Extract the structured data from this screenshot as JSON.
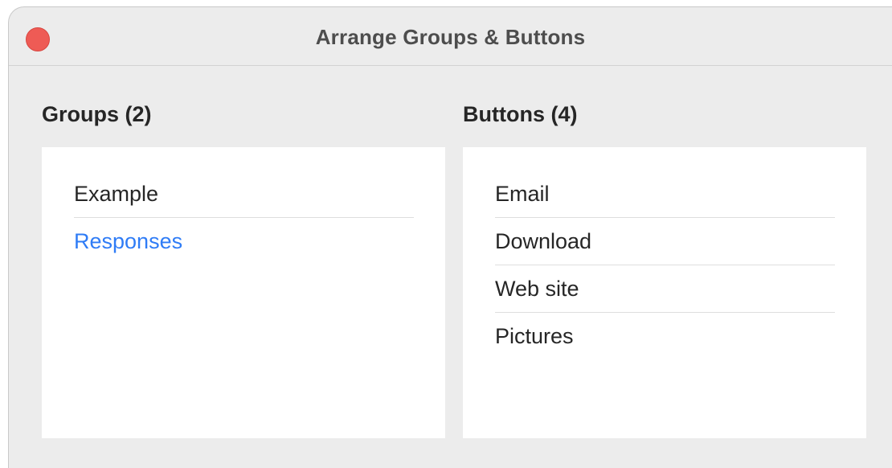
{
  "window": {
    "title": "Arrange Groups & Buttons"
  },
  "groups": {
    "heading": "Groups (2)",
    "items": [
      {
        "label": "Example",
        "selected": false
      },
      {
        "label": "Responses",
        "selected": true
      }
    ]
  },
  "buttons": {
    "heading": "Buttons (4)",
    "items": [
      {
        "label": "Email"
      },
      {
        "label": "Download"
      },
      {
        "label": "Web site"
      },
      {
        "label": "Pictures"
      }
    ]
  },
  "colors": {
    "close_button": "#ee5b55",
    "selected_text": "#2f7cf6",
    "window_background": "#ececec"
  }
}
